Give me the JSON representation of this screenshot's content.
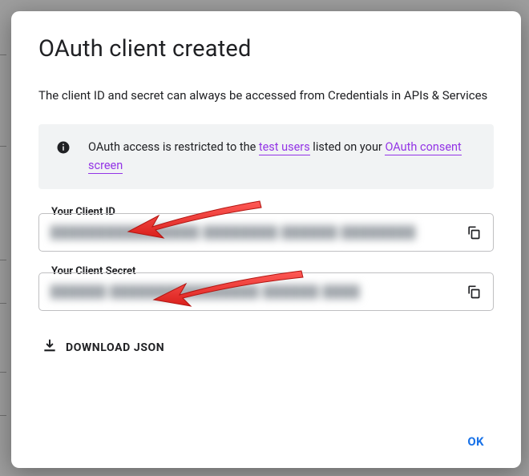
{
  "dialog": {
    "title": "OAuth client created",
    "subtitle": "The client ID and secret can always be accessed from Credentials in APIs & Services",
    "info_before": "OAuth access is restricted to the ",
    "info_link1": "test users",
    "info_mid": " listed on your ",
    "info_link2": "OAuth consent screen",
    "client_id_label": "Your Client ID",
    "client_id_value": "████████████████  ████████  ██████  ████████",
    "client_secret_label": "Your Client Secret",
    "client_secret_value": "██████  ████████████████  ██████  ████",
    "download_label": "DOWNLOAD JSON",
    "ok_label": "OK"
  }
}
